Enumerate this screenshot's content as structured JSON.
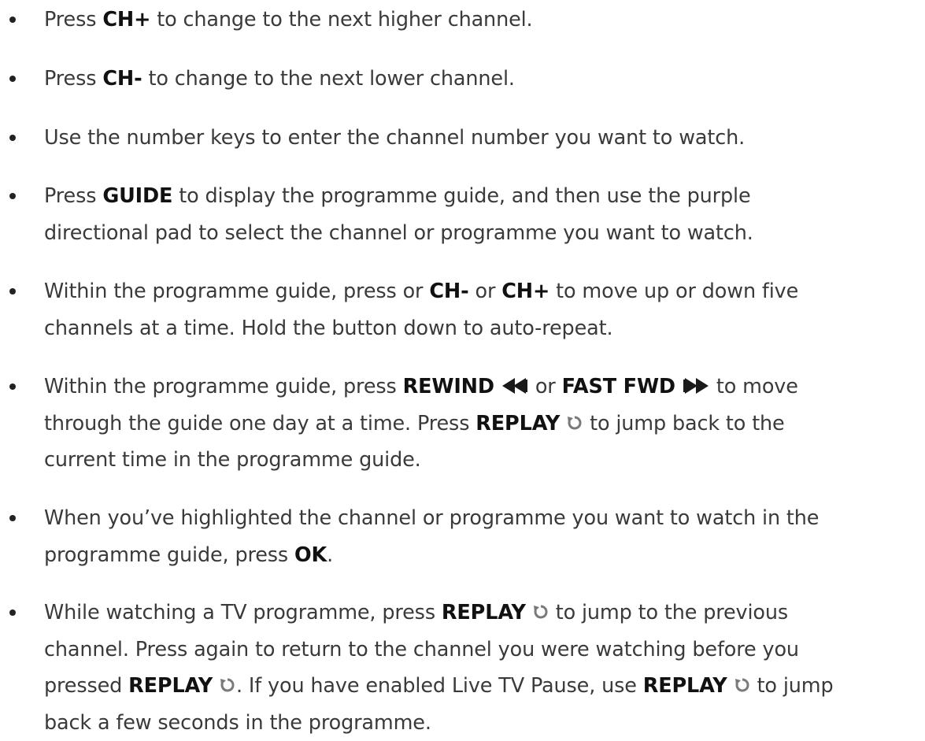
{
  "items": [
    {
      "parts": [
        "Press ",
        "CH+",
        " to change to the next higher channel."
      ]
    },
    {
      "parts": [
        "Press ",
        "CH-",
        " to change to the next lower channel."
      ]
    },
    {
      "parts": [
        "Use the number keys to enter the channel number you want to watch."
      ]
    },
    {
      "lines": [
        [
          "Press ",
          "GUIDE",
          " to display the programme guide, and then use the purple"
        ],
        [
          "directional pad to select the channel or programme you want to watch."
        ]
      ]
    },
    {
      "lines": [
        [
          "Within the programme guide, press or ",
          "CH-",
          " or ",
          "CH+",
          " to move up or down five"
        ],
        [
          "channels at a time. Hold the button down to auto-repeat."
        ]
      ]
    },
    {
      "lines": [
        [
          "Within the programme guide, press ",
          "REWIND",
          " or ",
          "FAST FWD",
          " to move"
        ],
        [
          "through the guide one day at a time. Press ",
          "REPLAY",
          " to jump back to the"
        ],
        [
          "current time in the programme guide."
        ]
      ]
    },
    {
      "lines": [
        [
          "When you’ve highlighted the channel or programme you want to watch in the"
        ],
        [
          "programme guide, press ",
          "OK",
          "."
        ]
      ]
    },
    {
      "lines": [
        [
          "While watching a TV programme, press ",
          "REPLAY",
          " to jump to the previous"
        ],
        [
          "channel. Press again to return to the channel you were watching before you"
        ],
        [
          "pressed ",
          "REPLAY",
          ". If you have enabled Live TV Pause, use ",
          "REPLAY",
          " to jump"
        ],
        [
          "back a few seconds in the programme."
        ]
      ]
    }
  ],
  "icons": {
    "rewind": "rewind-icon",
    "fast_fwd": "fast-forward-icon",
    "replay": "replay-icon"
  }
}
